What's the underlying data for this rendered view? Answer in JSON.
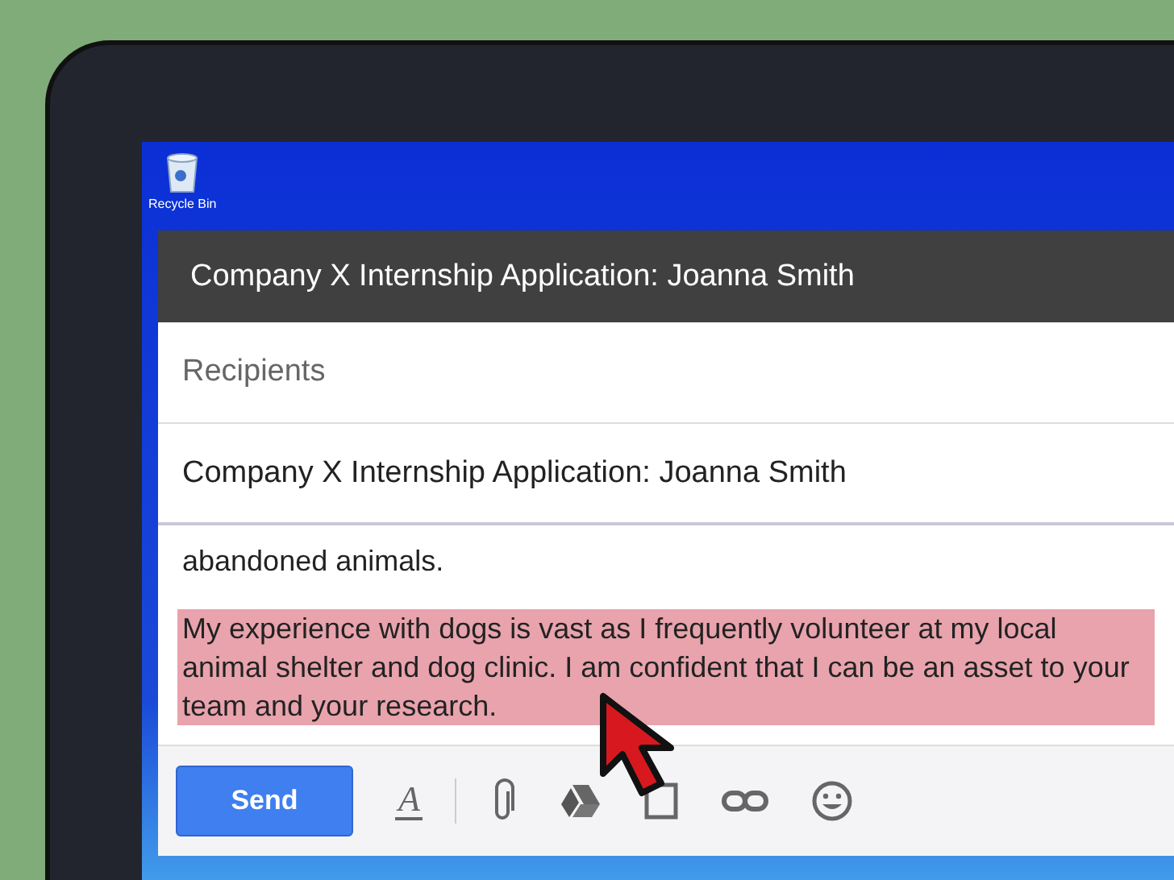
{
  "desktop": {
    "icons": [
      {
        "label": "Recycle Bin"
      }
    ]
  },
  "compose": {
    "title": "Company X Internship Application: Joanna Smith",
    "recipients": {
      "placeholder": "Recipients"
    },
    "subject": {
      "value": "Company X Internship Application: Joanna Smith"
    },
    "body": [
      {
        "text": "abandoned animals.",
        "highlighted": false
      },
      {
        "text": "My experience with dogs is vast as I frequently volunteer at my local animal shelter and dog clinic. I am confident that I can be an asset to your team and your research.",
        "highlighted": true
      }
    ],
    "send_button": "Send",
    "format_button": "A"
  }
}
